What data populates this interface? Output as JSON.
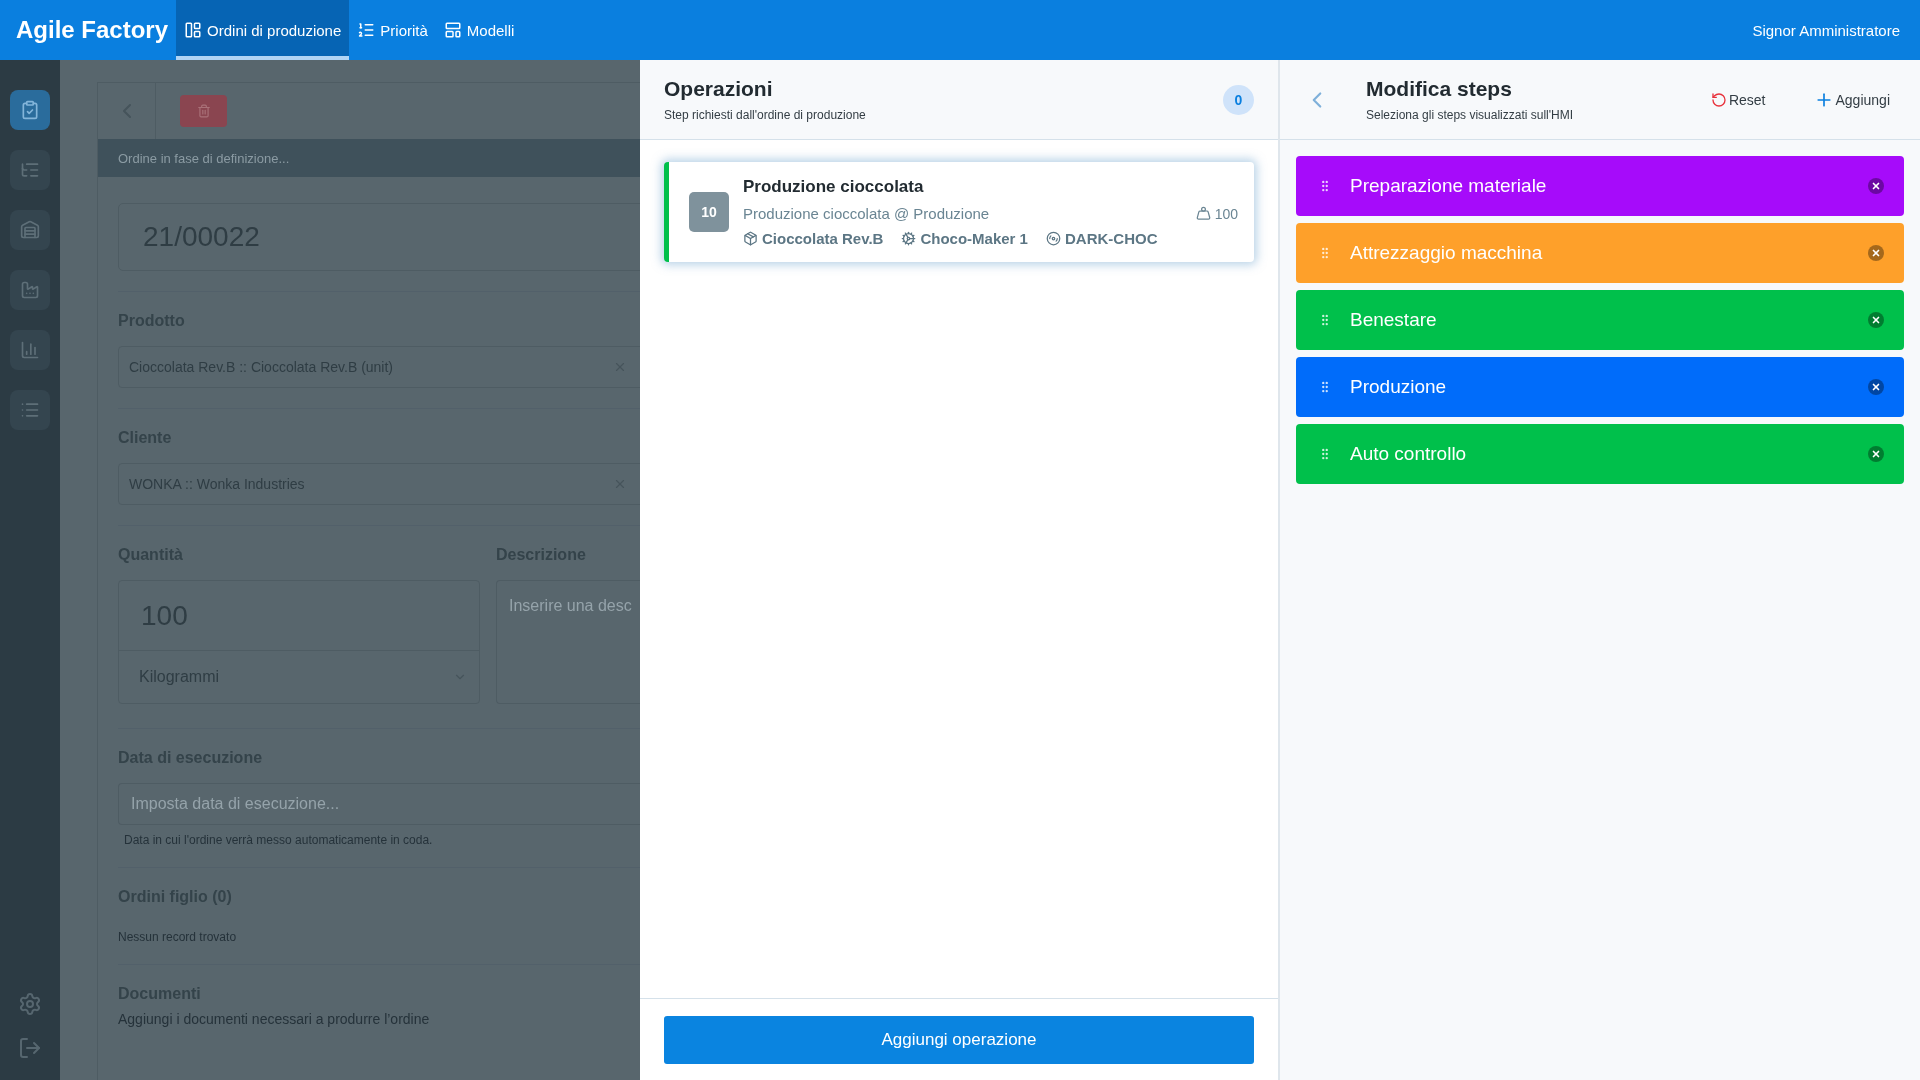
{
  "topbar": {
    "brand": "Agile Factory",
    "nav": [
      {
        "label": "Ordini di produzione",
        "selected": true
      },
      {
        "label": "Priorità",
        "selected": false
      },
      {
        "label": "Modelli",
        "selected": false
      }
    ],
    "user": "Signor Amministratore"
  },
  "sidebar": {
    "items": [
      {
        "selected": true
      },
      {
        "selected": false
      },
      {
        "selected": false
      },
      {
        "selected": false
      },
      {
        "selected": false
      },
      {
        "selected": false
      }
    ]
  },
  "order_form": {
    "status": "Ordine in fase di definizione...",
    "order_number": "21/00022",
    "product": {
      "label": "Prodotto",
      "value": "Cioccolata Rev.B :: Cioccolata Rev.B (unit)"
    },
    "customer": {
      "label": "Cliente",
      "value": "WONKA :: Wonka Industries"
    },
    "quantity": {
      "label": "Quantità",
      "value": "100",
      "unit": "Kilogrammi"
    },
    "description": {
      "label": "Descrizione",
      "placeholder": "Inserire una desc"
    },
    "execution_date": {
      "label": "Data di esecuzione",
      "placeholder": "Imposta data di esecuzione...",
      "hint": "Data in cui l'ordine verrà messo automaticamente in coda."
    },
    "child_orders": {
      "label": "Ordini figlio (0)",
      "empty": "Nessun record trovato"
    },
    "documents": {
      "label": "Documenti",
      "hint": "Aggiungi i documenti necessari a produrre l’ordine"
    }
  },
  "operations": {
    "title": "Operazioni",
    "subtitle": "Step richiesti dall'ordine di produzione",
    "count": "0",
    "cards": [
      {
        "number": "10",
        "title": "Produzione cioccolata",
        "subtitle": "Produzione cioccolata @ Produzione",
        "quantity": "100",
        "product": "Cioccolata Rev.B",
        "machine": "Choco-Maker 1",
        "recipe": "DARK-CHOC",
        "color": "#00c04b"
      }
    ],
    "add_button": "Aggiungi operazione"
  },
  "steps_panel": {
    "title": "Modifica steps",
    "subtitle": "Seleziona gli steps visualizzati sull'HMI",
    "reset": "Reset",
    "add": "Aggiungi",
    "steps": [
      {
        "label": "Preparazione materiale",
        "color": "#a60bfa"
      },
      {
        "label": "Attrezzaggio macchina",
        "color": "#fea02a"
      },
      {
        "label": "Benestare",
        "color": "#00c04b"
      },
      {
        "label": "Produzione",
        "color": "#006cfa"
      },
      {
        "label": "Auto controllo",
        "color": "#00c04b"
      }
    ]
  }
}
